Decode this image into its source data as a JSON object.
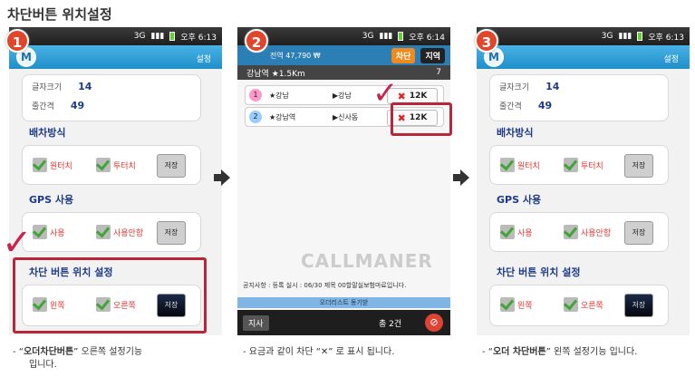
{
  "title": "차단버튼 위치설정",
  "phones": [
    {
      "badge": "1",
      "status": {
        "network": "3G",
        "time": "오후 6:13"
      },
      "app": {
        "logo": "M",
        "settings_label": "설정"
      },
      "font_size": {
        "label": "글자크기",
        "value": "14"
      },
      "interval": {
        "label": "줄간격",
        "value": "49"
      },
      "dispatch": {
        "title": "배차방식",
        "opt1": "원터치",
        "opt2": "투터치",
        "save": "저장"
      },
      "gps": {
        "title": "GPS 사용",
        "opt1": "사용",
        "opt2": "사용안함",
        "save": "저장"
      },
      "block": {
        "title": "차단 버튼 위치 설정",
        "opt1": "왼쪽",
        "opt2": "오른쪽",
        "save": "저장"
      }
    },
    {
      "badge": "2",
      "status": {
        "network": "3G",
        "time": "오후 6:14"
      },
      "header": {
        "summary": "전역 47,790 ₩",
        "block_btn": "차단",
        "region_btn": "지역"
      },
      "location": {
        "name": "강남역 ★1.5Km",
        "count": "7"
      },
      "rows": [
        {
          "num": "1",
          "from": "★강남",
          "to": "▶강남",
          "fare": "12K"
        },
        {
          "num": "2",
          "from": "★강남역",
          "to": "▶신사동",
          "fare": "12K"
        }
      ],
      "watermark": "CALLMANER",
      "notice": "공지사항 : 등록 실시 : 06/30 제목 00할말실보험마료입니다.",
      "progress": "오더리스트 동기받",
      "bottom": {
        "left": "지사",
        "right": "총 2건"
      }
    },
    {
      "badge": "3",
      "status": {
        "network": "3G",
        "time": "오후 6:13"
      },
      "app": {
        "logo": "M",
        "settings_label": "설정"
      },
      "font_size": {
        "label": "글자크기",
        "value": "14"
      },
      "interval": {
        "label": "줄간격",
        "value": "49"
      },
      "dispatch": {
        "title": "배차방식",
        "opt1": "원터치",
        "opt2": "투터치",
        "save": "저장"
      },
      "gps": {
        "title": "GPS 사용",
        "opt1": "사용",
        "opt2": "사용안함",
        "save": "저장"
      },
      "block": {
        "title": "차단 버튼 위치 설정",
        "opt1": "왼쪽",
        "opt2": "오른쪽",
        "save": "저장"
      }
    }
  ],
  "captions": {
    "c1_pre": "- “",
    "c1_bold": "오더차단버튼",
    "c1_post": "” 오른쪽 설정기능",
    "c1_line2": "입니다.",
    "c2": "- 요금과 같이 차단 “✕” 로 표시 됩니다.",
    "c3_pre": "- “",
    "c3_bold": "오더 차단버튼",
    "c3_post": "” 왼쪽 설정기능 입니다."
  }
}
